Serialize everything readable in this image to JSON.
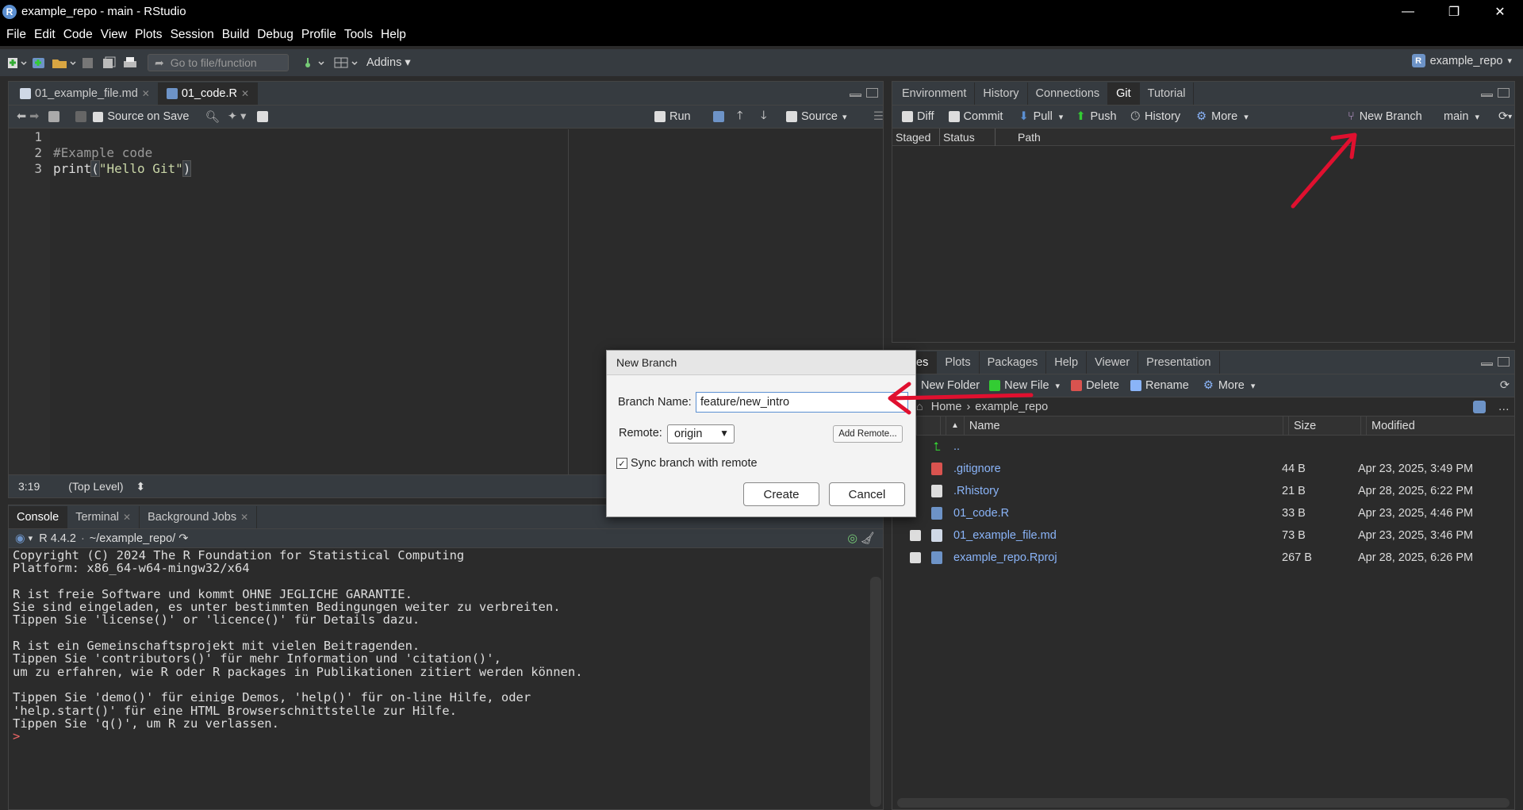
{
  "window": {
    "title": "example_repo - main - RStudio",
    "controls": [
      "—",
      "❐",
      "✕"
    ]
  },
  "menu": [
    "File",
    "Edit",
    "Code",
    "View",
    "Plots",
    "Session",
    "Build",
    "Debug",
    "Profile",
    "Tools",
    "Help"
  ],
  "toolbar": {
    "goto_placeholder": "Go to file/function",
    "addins_label": "Addins",
    "project_name": "example_repo",
    "project_badge": "R"
  },
  "editor": {
    "tabs": [
      {
        "label": "01_example_file.md",
        "active": false
      },
      {
        "label": "01_code.R",
        "active": true
      }
    ],
    "source_on_save": "Source on Save",
    "run_label": "Run",
    "source_label": "Source",
    "line_numbers": [
      "1",
      "2",
      "3"
    ],
    "code": {
      "line1": "",
      "line2": "#Example code",
      "line3_fn": "print",
      "line3_open": "(",
      "line3_str": "\"Hello Git\"",
      "line3_close": ")"
    },
    "status_pos": "3:19",
    "status_scope": "(Top Level)"
  },
  "console": {
    "tabs": [
      {
        "label": "Console",
        "active": true
      },
      {
        "label": "Terminal",
        "active": false
      },
      {
        "label": "Background Jobs",
        "active": false
      }
    ],
    "r_version": "R 4.4.2",
    "path": "~/example_repo/",
    "output": "Copyright (C) 2024 The R Foundation for Statistical Computing\nPlatform: x86_64-w64-mingw32/x64\n\nR ist freie Software und kommt OHNE JEGLICHE GARANTIE.\nSie sind eingeladen, es unter bestimmten Bedingungen weiter zu verbreiten.\nTippen Sie 'license()' or 'licence()' für Details dazu.\n\nR ist ein Gemeinschaftsprojekt mit vielen Beitragenden.\nTippen Sie 'contributors()' für mehr Information und 'citation()',\num zu erfahren, wie R oder R packages in Publikationen zitiert werden können.\n\nTippen Sie 'demo()' für einige Demos, 'help()' für on-line Hilfe, oder\n'help.start()' für eine HTML Browserschnittstelle zur Hilfe.\nTippen Sie 'q()', um R zu verlassen.\n",
    "prompt": ">"
  },
  "git_pane": {
    "tabs": [
      {
        "label": "Environment",
        "active": false
      },
      {
        "label": "History",
        "active": false
      },
      {
        "label": "Connections",
        "active": false
      },
      {
        "label": "Git",
        "active": true
      },
      {
        "label": "Tutorial",
        "active": false
      }
    ],
    "buttons": {
      "diff": "Diff",
      "commit": "Commit",
      "pull": "Pull",
      "push": "Push",
      "history": "History",
      "more": "More",
      "new_branch": "New Branch",
      "branch": "main"
    },
    "columns": [
      "Staged",
      "Status",
      "Path"
    ]
  },
  "files_pane": {
    "tabs": [
      {
        "label": "es",
        "active": true
      },
      {
        "label": "Plots",
        "active": false
      },
      {
        "label": "Packages",
        "active": false
      },
      {
        "label": "Help",
        "active": false
      },
      {
        "label": "Viewer",
        "active": false
      },
      {
        "label": "Presentation",
        "active": false
      }
    ],
    "buttons": {
      "new_folder": "New Folder",
      "new_file": "New File",
      "delete": "Delete",
      "rename": "Rename",
      "more": "More"
    },
    "breadcrumb_home": "Home",
    "breadcrumb_folder": "example_repo",
    "columns": {
      "name": "Name",
      "size": "Size",
      "modified": "Modified"
    },
    "parent": "..",
    "files": [
      {
        "name": ".gitignore",
        "size": "44 B",
        "modified": "Apr 23, 2025, 3:49 PM",
        "icon": "gitignore-icon",
        "color": "#d9534f",
        "checkbox": false
      },
      {
        "name": ".Rhistory",
        "size": "21 B",
        "modified": "Apr 28, 2025, 6:22 PM",
        "icon": "file-icon",
        "color": "#dddddd",
        "checkbox": false
      },
      {
        "name": "01_code.R",
        "size": "33 B",
        "modified": "Apr 23, 2025, 4:46 PM",
        "icon": "r-file-icon",
        "color": "#6d93c7",
        "checkbox": false
      },
      {
        "name": "01_example_file.md",
        "size": "73 B",
        "modified": "Apr 23, 2025, 3:46 PM",
        "icon": "md-file-icon",
        "color": "#cfd8e6",
        "checkbox": true
      },
      {
        "name": "example_repo.Rproj",
        "size": "267 B",
        "modified": "Apr 28, 2025, 6:26 PM",
        "icon": "rproj-icon",
        "color": "#6d93c7",
        "checkbox": true
      }
    ]
  },
  "dialog": {
    "title": "New Branch",
    "branch_label": "Branch Name:",
    "branch_value": "feature/new_intro",
    "remote_label": "Remote:",
    "remote_value": "origin",
    "add_remote": "Add Remote...",
    "sync_label": "Sync branch with remote",
    "create": "Create",
    "cancel": "Cancel"
  },
  "colors": {
    "accent": "#5b8fd1",
    "annotation_arrow": "#e0102f",
    "background": "#2b2b2b"
  }
}
